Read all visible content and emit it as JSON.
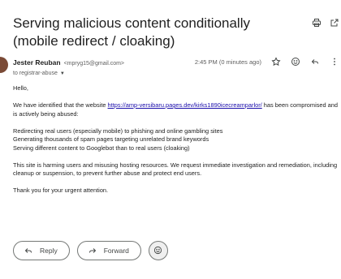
{
  "email": {
    "subject": "Serving malicious content conditionally (mobile redirect / cloaking)",
    "sender": {
      "name": "Jester Reuban",
      "email": "<mpryg15@gmail.com>"
    },
    "recipient": "to registrar-abuse",
    "timestamp": "2:45 PM (0 minutes ago)",
    "body": {
      "greeting": "Hello,",
      "intro_before_link": "We have identified that the website ",
      "link": "https://amp-versibaru.pages.dev/kirks1890icecreamparlor/",
      "intro_after_link": " has been compromised and is actively being abused:",
      "points": [
        "Redirecting real users (especially mobile) to phishing and online gambling sites",
        "Generating thousands of spam pages targeting unrelated brand keywords",
        "Serving different content to Googlebot than to real users (cloaking)"
      ],
      "request": "This site is harming users and misusing hosting resources. We request immediate investigation and remediation, including cleanup or suspension, to prevent further abuse and protect end users.",
      "closing": "Thank you for your urgent attention."
    }
  },
  "actions": {
    "reply_label": "Reply",
    "forward_label": "Forward"
  },
  "icons": {
    "print": "print-icon",
    "open_in_new": "open-in-new-window-icon",
    "star": "star-icon",
    "emoji": "emoji-icon",
    "reply": "reply-icon",
    "more": "more-vertical-icon",
    "forward": "forward-icon",
    "caret": "caret-down-icon"
  },
  "colors": {
    "link": "#1a0dab",
    "avatar": "#7a4a36",
    "text": "#202124",
    "muted": "#5e5e5e"
  }
}
